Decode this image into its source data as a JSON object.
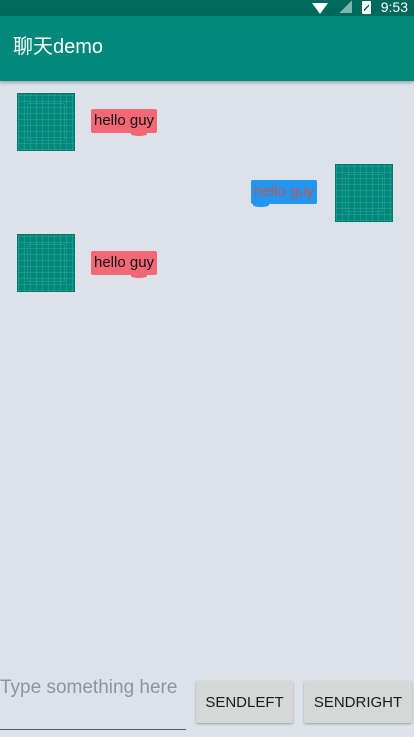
{
  "status_bar": {
    "time": "9:53",
    "icons": [
      "wifi-icon",
      "signal-icon",
      "battery-icon"
    ]
  },
  "app_bar": {
    "title": "聊天demo"
  },
  "chat": {
    "messages": [
      {
        "side": "left",
        "text": "hello guy"
      },
      {
        "side": "right",
        "text": "hello guy"
      },
      {
        "side": "left",
        "text": "hello guy"
      }
    ]
  },
  "input": {
    "value": "",
    "placeholder": "Type something here"
  },
  "buttons": {
    "send_left_label": "SENDLEFT",
    "send_right_label": "SENDRIGHT"
  },
  "colors": {
    "status_bar": "#00695c",
    "app_bar": "#00897b",
    "background": "#dbe2ea",
    "bubble_left": "#f46876",
    "bubble_right": "#2196f3",
    "bubble_right_text": "#c0574c",
    "button": "#d6d7d7"
  }
}
